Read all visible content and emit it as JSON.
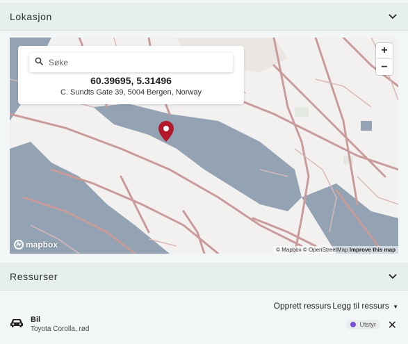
{
  "location_section": {
    "title": "Lokasjon"
  },
  "map": {
    "search_placeholder": "Søke",
    "coordinates": "60.39695, 5.31496",
    "address": "C. Sundts Gate 39, 5004 Bergen, Norway",
    "zoom_in": "+",
    "zoom_out": "−",
    "logo_text": "mapbox",
    "attribution": {
      "mapbox": "© Mapbox",
      "osm": "© OpenStreetMap",
      "improve": "Improve this map"
    },
    "colors": {
      "water": "#93a3b3",
      "land": "#f3f1ef",
      "road": "#c99b9b",
      "pin": "#b3192a"
    }
  },
  "resources_section": {
    "title": "Ressurser",
    "create_label": "Opprett ressurs",
    "add_label": "Legg til ressurs",
    "items": [
      {
        "icon": "car-icon",
        "title": "Bil",
        "subtitle": "Toyota Corolla, rød",
        "tag": "Utstyr",
        "tag_color": "#7a4fd8"
      }
    ]
  }
}
